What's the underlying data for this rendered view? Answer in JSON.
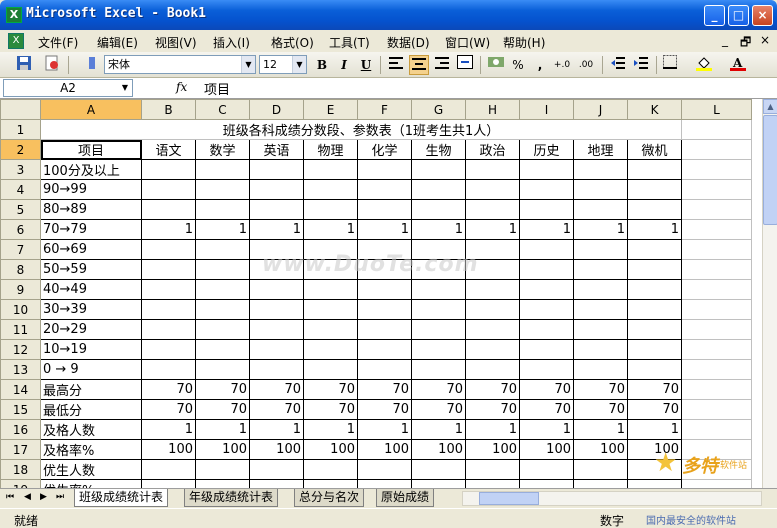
{
  "window": {
    "title": "Microsoft Excel - Book1",
    "min": "_",
    "max": "□",
    "close": "×"
  },
  "menu": {
    "items": [
      "文件(F)",
      "编辑(E)",
      "视图(V)",
      "插入(I)",
      "格式(O)",
      "工具(T)",
      "数据(D)",
      "窗口(W)",
      "帮助(H)"
    ],
    "mdi_min": "_",
    "mdi_restore": "🗗",
    "mdi_close": "×"
  },
  "toolbar": {
    "font_name": "宋体",
    "font_size": "12",
    "bold": "B",
    "italic": "I",
    "underline": "U",
    "percent": "%",
    "comma": ",",
    "inc_decimal": "+.0",
    "dec_decimal": ".00"
  },
  "formula_bar": {
    "name_box": "A2",
    "fx": "fx",
    "value": "项目"
  },
  "sheet": {
    "columns": [
      "A",
      "B",
      "C",
      "D",
      "E",
      "F",
      "G",
      "H",
      "I",
      "J",
      "K",
      "L"
    ],
    "title": "班级各科成绩分数段、参数表（1班考生共1人）",
    "header": [
      "项目",
      "语文",
      "数学",
      "英语",
      "物理",
      "化学",
      "生物",
      "政治",
      "历史",
      "地理",
      "微机"
    ],
    "rows": [
      {
        "n": "1"
      },
      {
        "n": "2"
      },
      {
        "n": "3",
        "label": "100分及以上",
        "values": []
      },
      {
        "n": "4",
        "label": "90→99",
        "values": []
      },
      {
        "n": "5",
        "label": "80→89",
        "values": []
      },
      {
        "n": "6",
        "label": "70→79",
        "values": [
          "1",
          "1",
          "1",
          "1",
          "1",
          "1",
          "1",
          "1",
          "1",
          "1"
        ]
      },
      {
        "n": "7",
        "label": "60→69",
        "values": []
      },
      {
        "n": "8",
        "label": "50→59",
        "values": []
      },
      {
        "n": "9",
        "label": "40→49",
        "values": []
      },
      {
        "n": "10",
        "label": "30→39",
        "values": []
      },
      {
        "n": "11",
        "label": "20→29",
        "values": []
      },
      {
        "n": "12",
        "label": "10→19",
        "values": []
      },
      {
        "n": "13",
        "label": "0 → 9",
        "values": []
      },
      {
        "n": "14",
        "label": "最高分",
        "values": [
          "70",
          "70",
          "70",
          "70",
          "70",
          "70",
          "70",
          "70",
          "70",
          "70"
        ]
      },
      {
        "n": "15",
        "label": "最低分",
        "values": [
          "70",
          "70",
          "70",
          "70",
          "70",
          "70",
          "70",
          "70",
          "70",
          "70"
        ]
      },
      {
        "n": "16",
        "label": "及格人数",
        "values": [
          "1",
          "1",
          "1",
          "1",
          "1",
          "1",
          "1",
          "1",
          "1",
          "1"
        ]
      },
      {
        "n": "17",
        "label": "及格率%",
        "values": [
          "100",
          "100",
          "100",
          "100",
          "100",
          "100",
          "100",
          "100",
          "100",
          "100"
        ]
      },
      {
        "n": "18",
        "label": "优生人数",
        "values": []
      },
      {
        "n": "19",
        "label": "优生率%",
        "values": []
      }
    ]
  },
  "tabs": [
    "班级成绩统计表",
    "年级成绩统计表",
    "总分与名次",
    "原始成绩"
  ],
  "status": {
    "left": "就绪",
    "right": "数字"
  },
  "watermark": "www.DuoTe.com",
  "corner_logo": {
    "brand": "多特",
    "sub": "软件站",
    "tag": "国内最安全的软件站"
  }
}
